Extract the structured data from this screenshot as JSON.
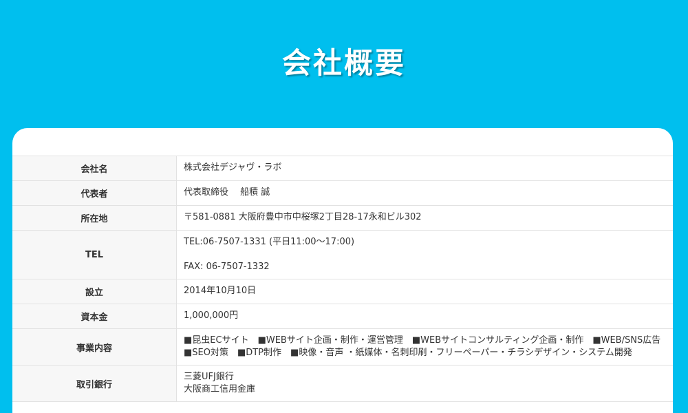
{
  "page": {
    "title": "会社概要",
    "bg_color": "#00bfee"
  },
  "company": {
    "rows": [
      {
        "label": "会社名",
        "value": "株式会社デジャヴ・ラボ"
      },
      {
        "label": "代表者",
        "value": "代表取締役　 船積 誠"
      },
      {
        "label": "所在地",
        "value": "〒581-0881 大阪府豊中市中桜塚2丁目28-17永和ビル302"
      },
      {
        "label": "TEL",
        "value_tel": "TEL:06-7507-1331 (平日11:00〜17:00)",
        "value_fax": "FAX: 06-7507-1332"
      },
      {
        "label": "設立",
        "value": "2014年10月10日"
      },
      {
        "label": "資本金",
        "value": "1,000,000円"
      },
      {
        "label": "事業内容",
        "value": "■昆虫ECサイト　■WEBサイト企画・制作・運営管理　■WEBサイトコンサルティング企画・制作　■WEB/SNS広告　■SEO対策　■DTP制作　■映像・音声 ・紙媒体・名刺印刷・フリーペーパー・チラシデザイン・システム開発"
      },
      {
        "label": "取引銀行",
        "value_1": "三菱UFJ銀行",
        "value_2": "大阪商工信用金庫"
      }
    ]
  }
}
